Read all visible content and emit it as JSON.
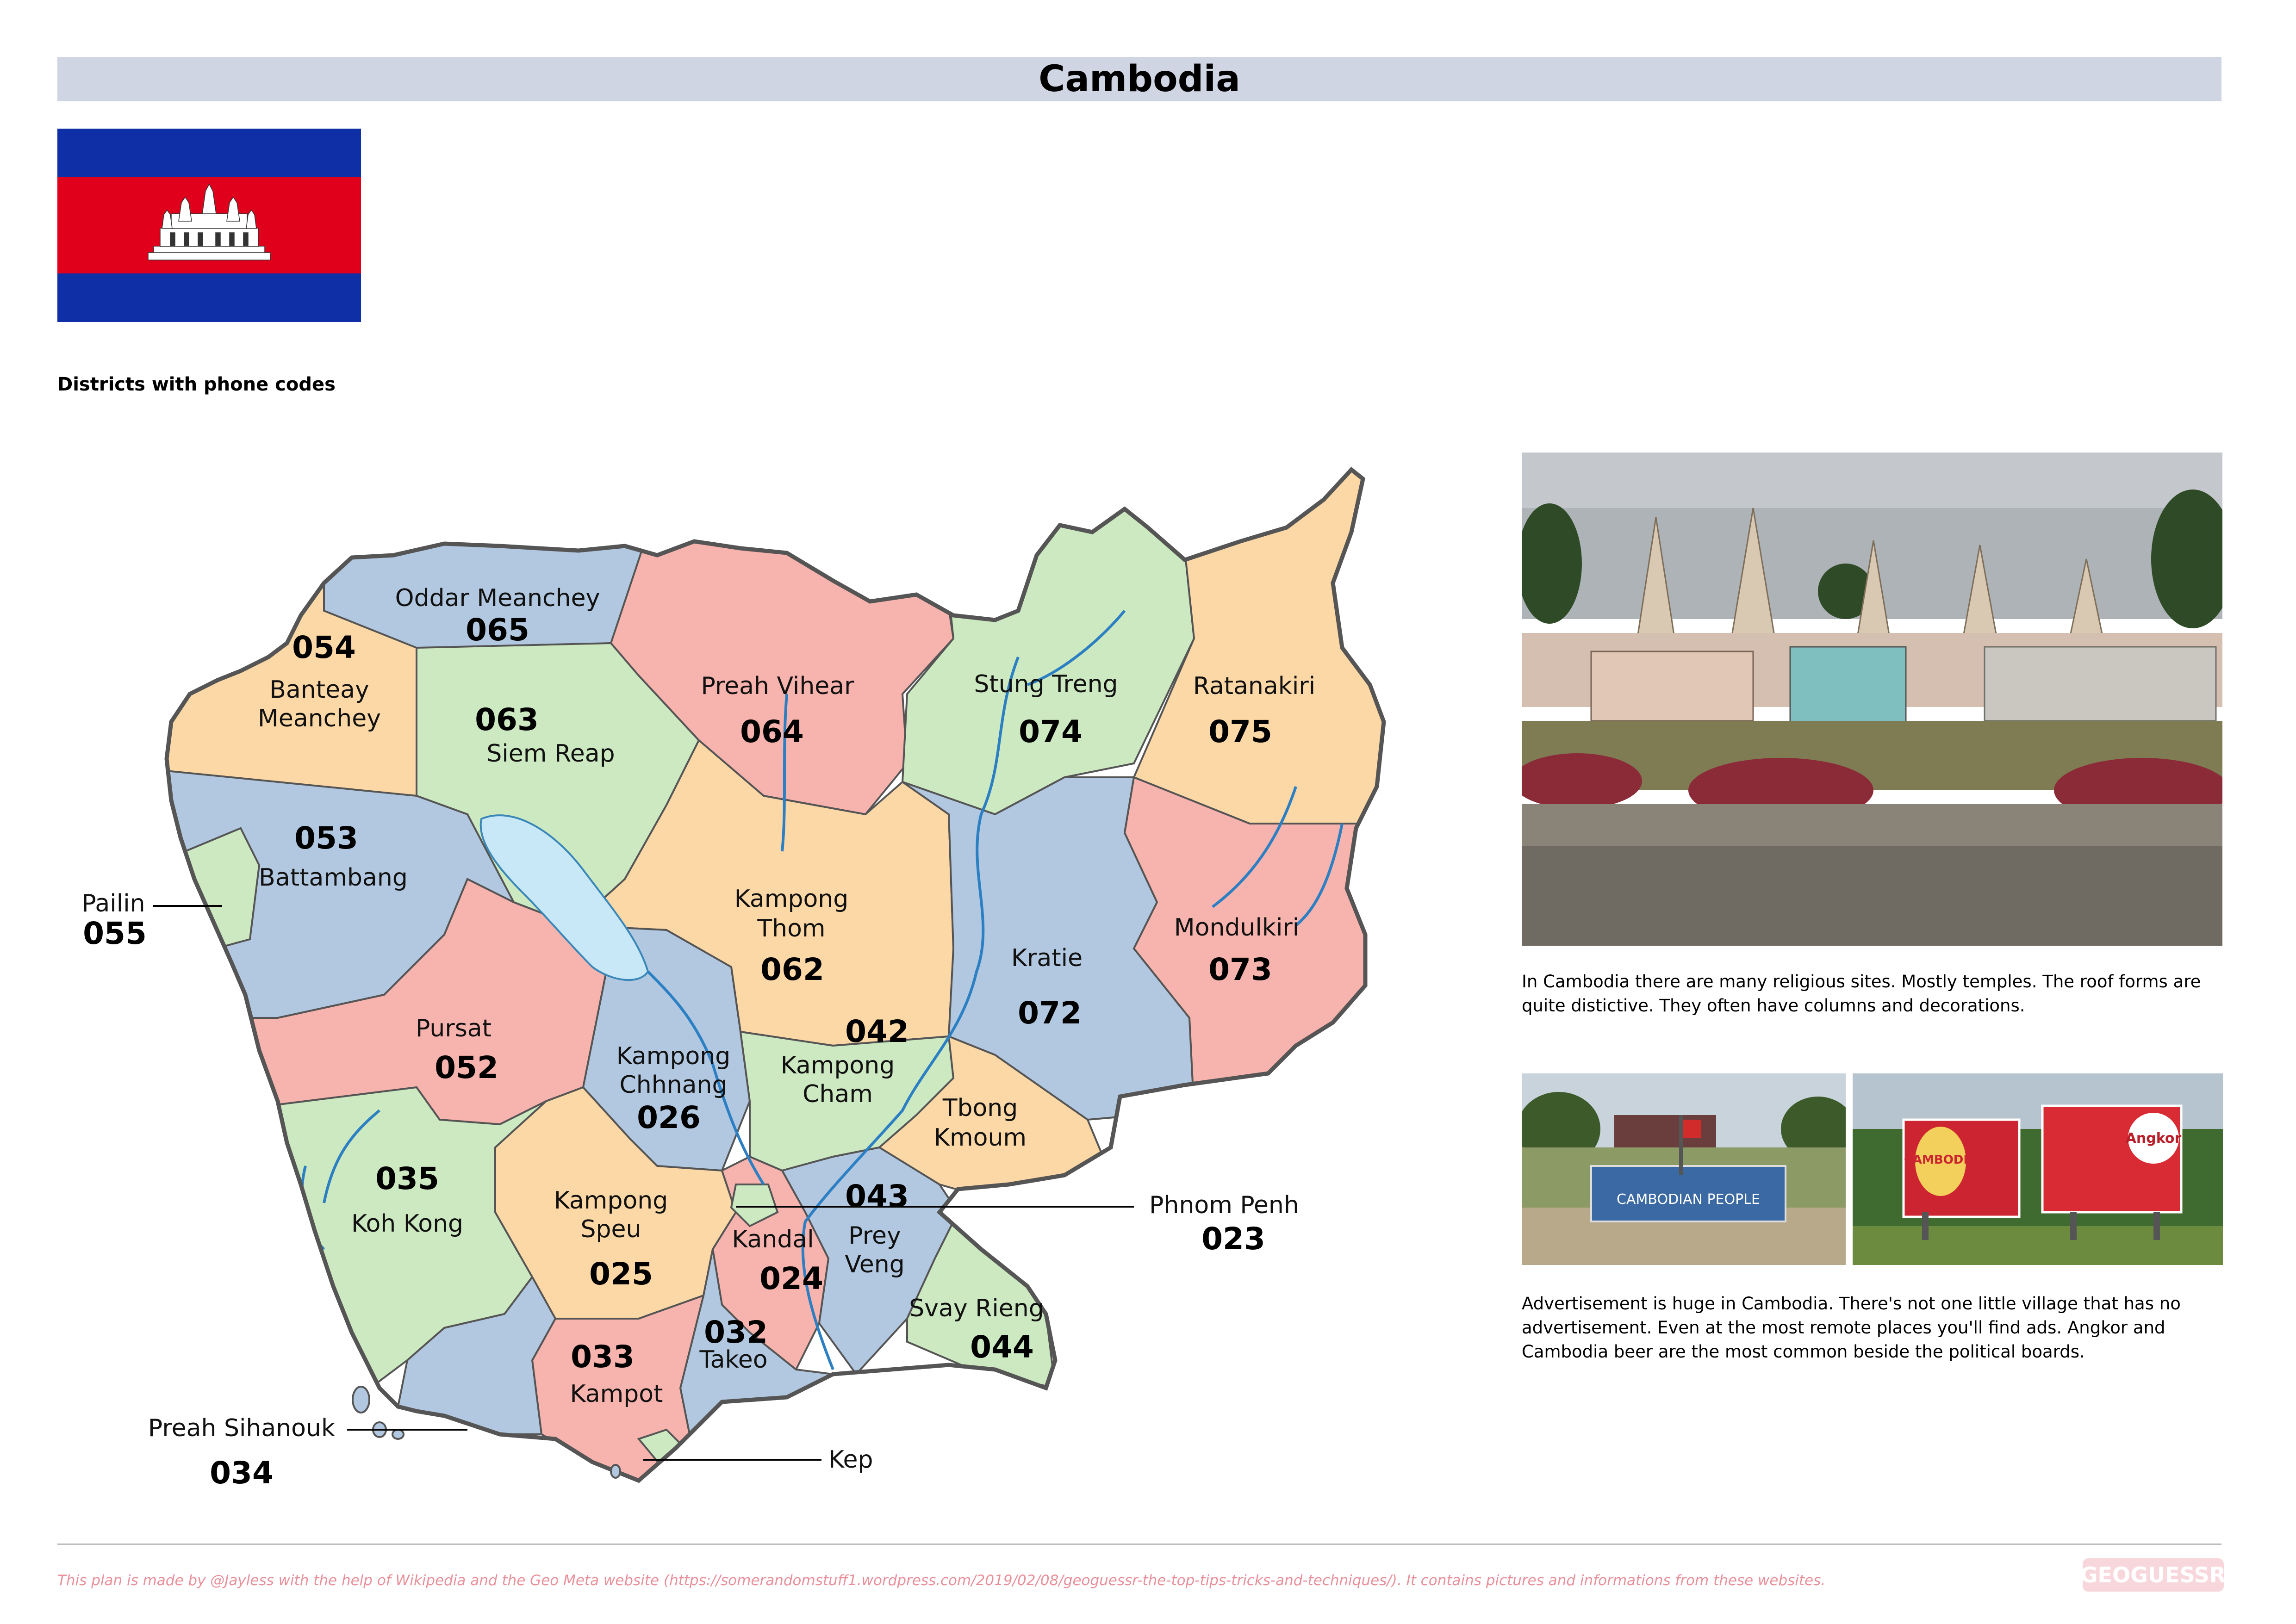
{
  "header": {
    "title": "Cambodia"
  },
  "flag": {
    "name": "cambodia-flag",
    "colors": {
      "blue": "#0f2fa6",
      "red": "#e0001c",
      "white": "#ffffff"
    }
  },
  "map": {
    "subtitle": "Districts with phone codes",
    "colors": {
      "orange": "#fcd8a6",
      "blue": "#b2c8e0",
      "green": "#cde9c1",
      "red": "#f7b3ad",
      "lake": "#c9e8f7",
      "border": "#555555"
    },
    "provinces": [
      {
        "name": "Oddar Meanchey",
        "code": "065"
      },
      {
        "name": "Banteay\nMeanchey",
        "code": "054"
      },
      {
        "name": "Siem Reap",
        "code": "063"
      },
      {
        "name": "Preah Vihear",
        "code": "064"
      },
      {
        "name": "Stung Treng",
        "code": "074"
      },
      {
        "name": "Ratanakiri",
        "code": "075"
      },
      {
        "name": "Battambang",
        "code": "053"
      },
      {
        "name": "Pailin",
        "code": "055"
      },
      {
        "name": "Kampong\nThom",
        "code": "062"
      },
      {
        "name": "Kratie",
        "code": "072"
      },
      {
        "name": "Mondulkiri",
        "code": "073"
      },
      {
        "name": "Pursat",
        "code": "052"
      },
      {
        "name": "Kampong\nChhnang",
        "code": "026"
      },
      {
        "name": "Kampong\nCham",
        "code": "042"
      },
      {
        "name": "Tbong\nKmoum",
        "code": ""
      },
      {
        "name": "Koh Kong",
        "code": "035"
      },
      {
        "name": "Kampong\nSpeu",
        "code": "025"
      },
      {
        "name": "Kandal",
        "code": "024"
      },
      {
        "name": "Prey\nVeng",
        "code": "043"
      },
      {
        "name": "Phnom Penh",
        "code": "023"
      },
      {
        "name": "Svay Rieng",
        "code": "044"
      },
      {
        "name": "Takeo",
        "code": "032"
      },
      {
        "name": "Kampot",
        "code": "033"
      },
      {
        "name": "Preah Sihanouk",
        "code": "034"
      },
      {
        "name": "Kep",
        "code": ""
      }
    ]
  },
  "photos": [
    {
      "name": "temple-photo",
      "caption": "In Cambodia there are many religious sites. Mostly temples. The roof forms are quite distictive. They often have columns and decorations."
    },
    {
      "name": "cambodian-people-sign-photo",
      "sign_text": "CAMBODIAN PEOPLE"
    },
    {
      "name": "beer-billboards-photo",
      "brand_1": "CAMBODIA",
      "brand_2": "Angkor"
    }
  ],
  "captions": {
    "ads": "Advertisement is huge in Cambodia. There's not one little village that has no advertisement. Even at the most remote places you'll find ads. Angkor and Cambodia beer are the most common beside the political boards."
  },
  "footer": {
    "text": "This plan is made by @Jayless with the help of Wikipedia and the Geo Meta website (https://somerandomstuff1.wordpress.com/2019/02/08/geoguessr-the-top-tips-tricks-and-techniques/). It contains pictures and informations from these websites.",
    "logo": "GEOGUESSR"
  }
}
